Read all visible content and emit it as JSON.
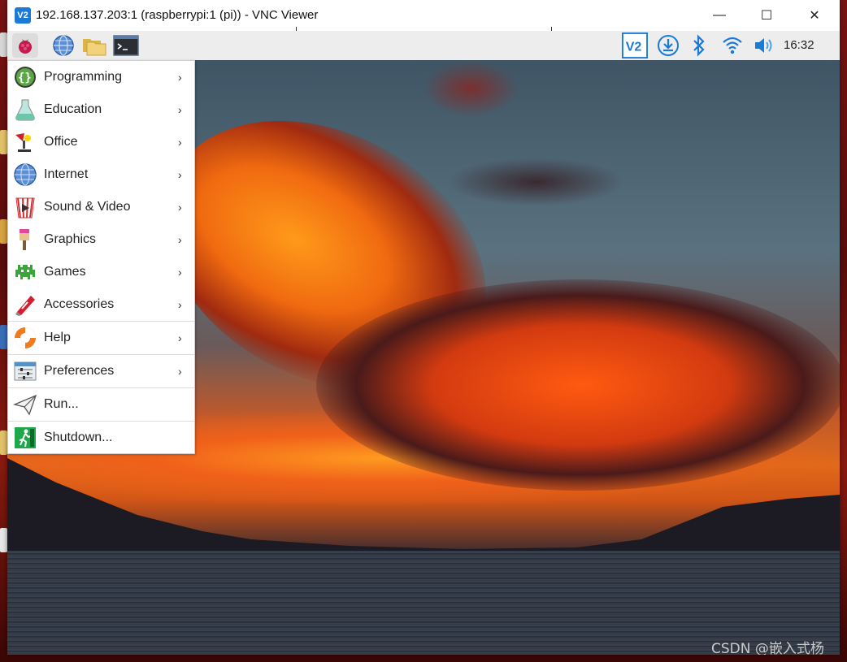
{
  "window": {
    "title": "192.168.137.203:1 (raspberrypi:1 (pi)) - VNC Viewer",
    "app_icon_text": "V2",
    "minimize": "—",
    "maximize": "☐",
    "close": "✕"
  },
  "taskbar": {
    "launchers": [
      {
        "name": "raspberry-icon"
      },
      {
        "name": "web-browser-icon"
      },
      {
        "name": "file-manager-icon"
      },
      {
        "name": "terminal-icon"
      }
    ],
    "tray": [
      "vnc-icon",
      "download-icon",
      "bluetooth-icon",
      "wifi-icon",
      "volume-icon"
    ],
    "clock": "16:32"
  },
  "menu": {
    "items": [
      {
        "label": "Programming",
        "icon": "programming-icon",
        "submenu": true
      },
      {
        "label": "Education",
        "icon": "education-icon",
        "submenu": true
      },
      {
        "label": "Office",
        "icon": "office-icon",
        "submenu": true
      },
      {
        "label": "Internet",
        "icon": "internet-icon",
        "submenu": true
      },
      {
        "label": "Sound & Video",
        "icon": "sound-video-icon",
        "submenu": true
      },
      {
        "label": "Graphics",
        "icon": "graphics-icon",
        "submenu": true
      },
      {
        "label": "Games",
        "icon": "games-icon",
        "submenu": true
      },
      {
        "label": "Accessories",
        "icon": "accessories-icon",
        "submenu": true
      },
      {
        "label": "Help",
        "icon": "help-icon",
        "submenu": true
      },
      {
        "label": "Preferences",
        "icon": "preferences-icon",
        "submenu": true
      },
      {
        "label": "Run...",
        "icon": "run-icon",
        "submenu": false
      },
      {
        "label": "Shutdown...",
        "icon": "shutdown-icon",
        "submenu": false
      }
    ],
    "arrow": "›"
  },
  "watermark": "CSDN @嵌入式杨",
  "colors": {
    "accent": "#1a7ad6",
    "menu_bg": "#ffffff",
    "taskbar_bg": "#ededed"
  }
}
